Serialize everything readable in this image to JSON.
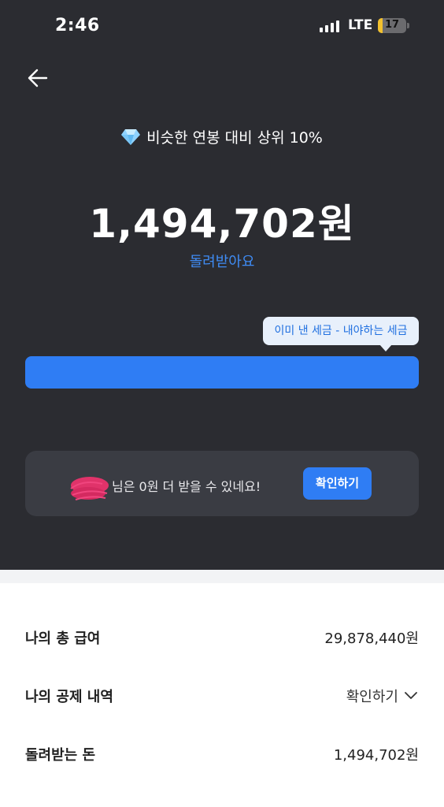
{
  "status_bar": {
    "time": "2:46",
    "network": "LTE",
    "battery": "17",
    "battery_fraction": 0.17
  },
  "summary": {
    "rank_text": "비슷한 연봉 대비 상위 10%",
    "amount": "1,494,702원",
    "refund_label": "돌려받아요",
    "tooltip": "이미 낸 세금 - 내야하는 세금"
  },
  "card": {
    "message": "님은 0원 더 받을 수 있네요!",
    "button_label": "확인하기"
  },
  "details": {
    "rows": [
      {
        "label": "나의 총 급여",
        "value": "29,878,440원"
      },
      {
        "label": "나의 공제 내역",
        "value": "확인하기"
      },
      {
        "label": "돌려받는 돈",
        "value": "1,494,702원"
      }
    ]
  },
  "colors": {
    "accent": "#2f7df4",
    "dark_bg": "#2b2c31",
    "card_bg": "#3a3c43"
  },
  "icons": {
    "back": "arrow-left-icon",
    "rank": "diamond-icon",
    "expand": "chevron-down-icon"
  }
}
